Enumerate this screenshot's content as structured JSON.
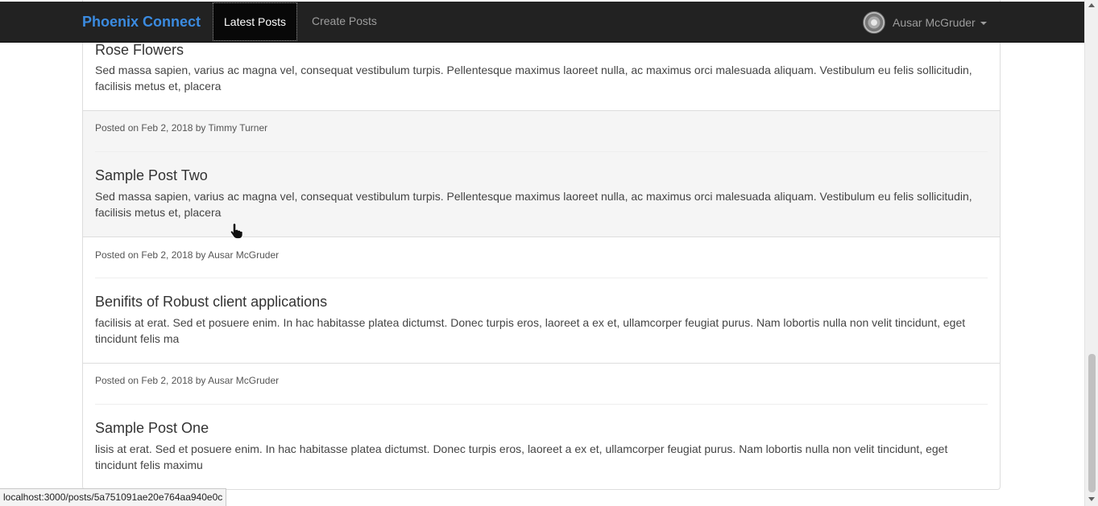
{
  "navbar": {
    "brand": "Phoenix Connect",
    "links": [
      {
        "label": "Latest Posts",
        "active": true
      },
      {
        "label": "Create Posts",
        "active": false
      }
    ],
    "user": {
      "name": "Ausar McGruder",
      "avatar_icon": "avatar-image"
    }
  },
  "posts": [
    {
      "title": "Rose Flowers",
      "body": "Sed massa sapien, varius ac magna vel, consequat vestibulum turpis. Pellentesque maximus laoreet nulla, ac maximus orci malesuada aliquam. Vestibulum eu felis sollicitudin, facilisis metus et, placera"
    },
    {
      "meta": "Posted on Feb 2, 2018 by Timmy Turner",
      "title": "Sample Post Two",
      "body": "Sed massa sapien, varius ac magna vel, consequat vestibulum turpis. Pellentesque maximus laoreet nulla, ac maximus orci malesuada aliquam. Vestibulum eu felis sollicitudin, facilisis metus et, placera"
    },
    {
      "meta": "Posted on Feb 2, 2018 by Ausar McGruder",
      "title": "Benifits of Robust client applications",
      "body": "facilisis at erat. Sed et posuere enim. In hac habitasse platea dictumst. Donec turpis eros, laoreet a ex et, ullamcorper feugiat purus. Nam lobortis nulla non velit tincidunt, eget tincidunt felis ma"
    },
    {
      "meta": "Posted on Feb 2, 2018 by Ausar McGruder",
      "title": "Sample Post One",
      "body": "lisis at erat. Sed et posuere enim. In hac habitasse platea dictumst. Donec turpis eros, laoreet a ex et, ullamcorper feugiat purus. Nam lobortis nulla non velit tincidunt, eget tincidunt felis maximu"
    }
  ],
  "statusbar": {
    "url": "localhost:3000/posts/5a751091ae20e764aa940e0c"
  },
  "colors": {
    "navbar_bg": "#222222",
    "brand": "#3b8be0",
    "hover_row": "#f5f5f5"
  }
}
